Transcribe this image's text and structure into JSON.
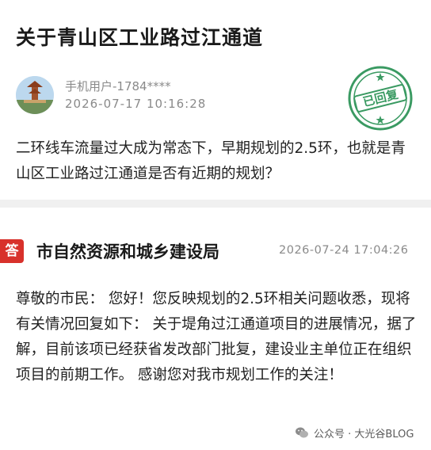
{
  "question": {
    "title": "关于青山区工业路过江通道",
    "user_name": "手机用户-1784****",
    "timestamp": "2026-07-17 10:16:28",
    "stamp_label": "已回复",
    "body": "二环线车流量过大成为常态下，早期规划的2.5环，也就是青山区工业路过江通道是否有近期的规划？"
  },
  "answer": {
    "badge": "答",
    "department": "市自然资源和城乡建设局",
    "timestamp": "2026-07-24 17:04:26",
    "body": "尊敬的市民： 您好！您反映规划的2.5环相关问题收悉，现将有关情况回复如下：  关于堤角过江通道项目的进展情况，据了解，目前该项已经获省发改部门批复，建设业主单位正在组织项目的前期工作。 感谢您对我市规划工作的关注！"
  },
  "watermark": {
    "text": "公众号 · 大光谷BLOG",
    "icon": "wechat-icon"
  },
  "colors": {
    "badge_red": "#d8312b",
    "stamp_green": "#3a9a62",
    "meta_gray": "#8a8a8a"
  }
}
